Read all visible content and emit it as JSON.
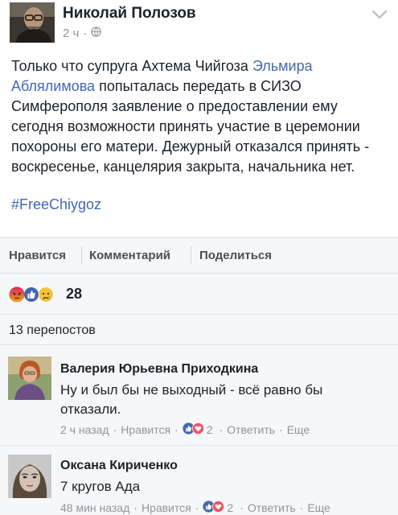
{
  "post": {
    "author": "Николай Полозов",
    "time": "2 ч",
    "text_before": "Только что супруга Ахтема Чийгоза ",
    "tagged_person": "Эльмира Аблялимова",
    "text_after": " попыталась передать в СИЗО Симферополя заявление о предоставлении ему сегодня возможности принять участие в церемонии похороны его матери. Дежурный отказался принять - воскресенье, канцелярия закрыта, начальника нет.",
    "hashtag": "#FreeChiygoz"
  },
  "actions": {
    "like": "Нравится",
    "comment": "Комментарий",
    "share": "Поделиться"
  },
  "reactions": {
    "icons": [
      "angry-icon",
      "like-icon",
      "sad-icon"
    ],
    "count": "28"
  },
  "shares": "13 перепостов",
  "comments": [
    {
      "name": "Валерия Юрьевна Приходкина",
      "text": "Ну и был бы не выходный - всё равно бы отказали.",
      "time": "2 ч назад",
      "like": "Нравится",
      "reaction_count": "2",
      "reply": "Ответить",
      "more": "Еще"
    },
    {
      "name": "Оксана Кириченко",
      "text": "7 кругов Ада",
      "time": "48 мин назад",
      "like": "Нравится",
      "reaction_count": "2",
      "reply": "Ответить",
      "more": "Еще"
    }
  ],
  "colors": {
    "link": "#4267b2",
    "meta": "#90949c",
    "panel": "#f6f7f9",
    "like_blue": "#4267b2",
    "angry": "#e9710f",
    "sad": "#f5c33b"
  }
}
